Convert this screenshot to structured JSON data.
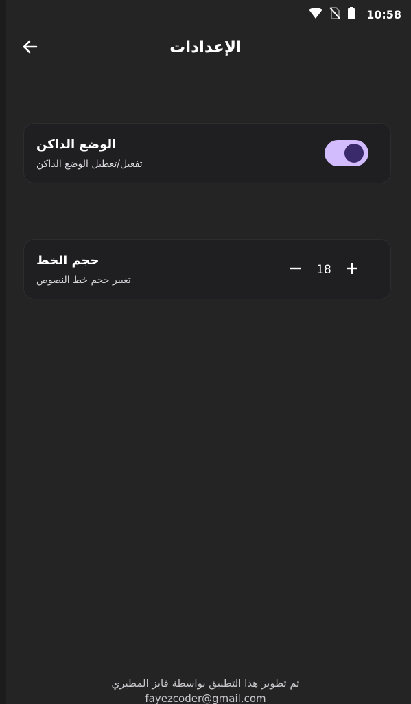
{
  "status_bar": {
    "time": "10:58",
    "icons": [
      "wifi-icon",
      "no-sim-icon",
      "battery-icon"
    ]
  },
  "app_bar": {
    "title": "الإعدادات",
    "back_icon": "arrow-left-icon"
  },
  "dark_mode": {
    "title": "الوضع الداكن",
    "subtitle": "تفعيل/تعطيل الوضع الداكن",
    "enabled": true
  },
  "font_size": {
    "title": "حجم الخط",
    "subtitle": "تغيير حجم خط النصوص",
    "value": "18",
    "decrease_icon": "minus-icon",
    "increase_icon": "plus-icon"
  },
  "footer": {
    "credit": "تم تطوير هذا التطبيق بواسطة فايز المطيري",
    "email": "fayezcoder@gmail.com"
  },
  "colors": {
    "background": "#242424",
    "card": "#1f1e21",
    "toggle_track": "#d3bcfd",
    "toggle_knob": "#3a2a6b",
    "text": "#ffffff",
    "muted_text": "#c9c7cc"
  }
}
